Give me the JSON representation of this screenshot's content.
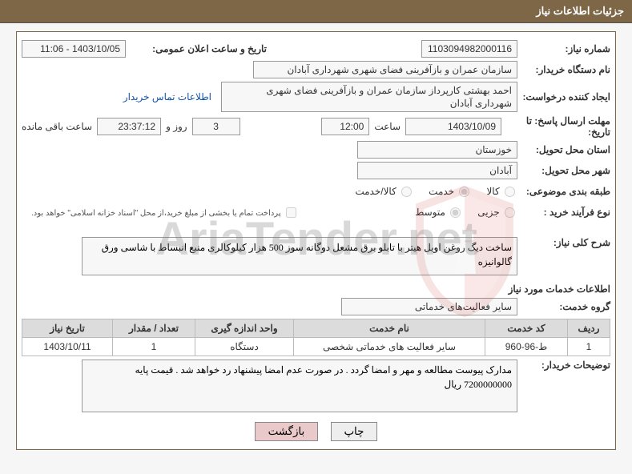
{
  "page": {
    "title": "جزئیات اطلاعات نیاز"
  },
  "need_no": {
    "label": "شماره نیاز:",
    "value": "1103094982000116"
  },
  "announce": {
    "label": "تاریخ و ساعت اعلان عمومی:",
    "value": "1403/10/05 - 11:06"
  },
  "buyer": {
    "label": "نام دستگاه خریدار:",
    "value": "سازمان عمران و بازآفرینی فضای شهری شهرداری آبادان"
  },
  "requester": {
    "label": "ایجاد کننده درخواست:",
    "value": "احمد بهشتی کارپرداز سازمان عمران و بازآفرینی فضای شهری شهرداری آبادان",
    "link": "اطلاعات تماس خریدار"
  },
  "deadline": {
    "label": "مهلت ارسال پاسخ: تا تاریخ:",
    "date": "1403/10/09",
    "time_prefix": "ساعت",
    "time": "12:00",
    "days": "3",
    "days_label_pre": "روز و",
    "remain": "23:37:12",
    "remain_suffix": "ساعت باقی مانده"
  },
  "province": {
    "label": "استان محل تحویل:",
    "value": "خوزستان"
  },
  "city": {
    "label": "شهر محل تحویل:",
    "value": "آبادان"
  },
  "classification": {
    "label": "طبقه بندی موضوعی:",
    "opts": {
      "goods": "کالا",
      "service": "خدمت",
      "goods_service": "کالا/خدمت"
    },
    "value": "service"
  },
  "process_type": {
    "label": "نوع فرآیند خرید :",
    "opts": {
      "minor": "جزیی",
      "medium": "متوسط"
    },
    "value": "medium",
    "escrow": "پرداخت تمام یا بخشی از مبلغ خرید،از محل \"اسناد خزانه اسلامی\" خواهد بود.",
    "escrow_checked": false
  },
  "need_description": {
    "label": "شرح کلی نیاز:",
    "value": "ساخت دیگ روغن اویل هیتر با تابلو برق مشعل دوگانه سوز 500 هزار کیلوکالری منبع انبساط با شاسی ورق گالوانیزه"
  },
  "services_heading": "اطلاعات خدمات مورد نیاز",
  "service_group": {
    "label": "گروه خدمت:",
    "value": "سایر فعالیت‌های خدماتی"
  },
  "table": {
    "headers": [
      "ردیف",
      "کد خدمت",
      "نام خدمت",
      "واحد اندازه گیری",
      "تعداد / مقدار",
      "تاریخ نیاز"
    ],
    "rows": [
      {
        "idx": "1",
        "code": "ط-96-960",
        "name": "سایر فعالیت های خدماتی شخصی",
        "unit": "دستگاه",
        "qty": "1",
        "need_date": "1403/10/11"
      }
    ]
  },
  "buyer_notes": {
    "label": "توضیحات خریدار:",
    "value": "مدارک پیوست مطالعه و مهر و امضا گردد . در صورت عدم امضا پیشنهاد رد خواهد شد . قیمت پایه 7200000000 ریال"
  },
  "buttons": {
    "print": "چاپ",
    "back": "بازگشت"
  },
  "watermark": "AriaTender.net"
}
